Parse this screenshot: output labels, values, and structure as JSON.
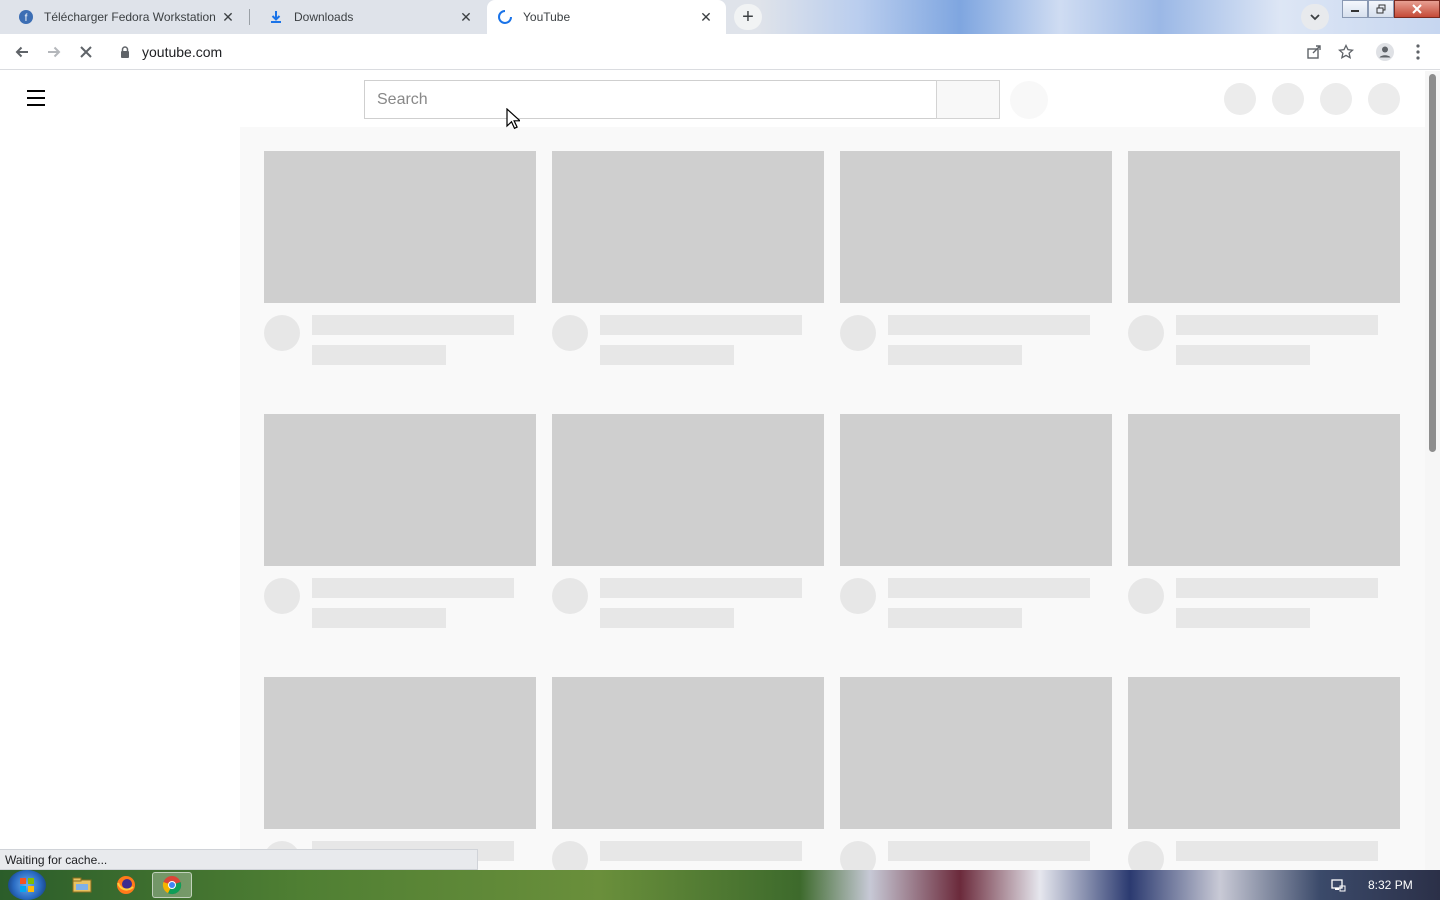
{
  "browser": {
    "tabs": [
      {
        "label": "Télécharger Fedora Workstation",
        "icon": "fedora-icon",
        "active": false
      },
      {
        "label": "Downloads",
        "icon": "download-icon",
        "active": false
      },
      {
        "label": "YouTube",
        "icon": "loading-spinner-icon",
        "active": true
      }
    ],
    "close_glyph": "✕",
    "new_tab_glyph": "+",
    "url": "youtube.com",
    "status_text": "Waiting for cache..."
  },
  "youtube": {
    "search_placeholder": "Search",
    "skeleton_rows": 3,
    "skeleton_columns": 4
  },
  "taskbar": {
    "apps": [
      "file-explorer-icon",
      "firefox-icon",
      "chrome-icon"
    ],
    "active_app": "chrome-icon",
    "clock": "8:32 PM"
  },
  "colors": {
    "skeleton_thumb": "#cfcfcf",
    "skeleton_text": "#e7e7e7",
    "content_bg": "#f9f9f9"
  }
}
